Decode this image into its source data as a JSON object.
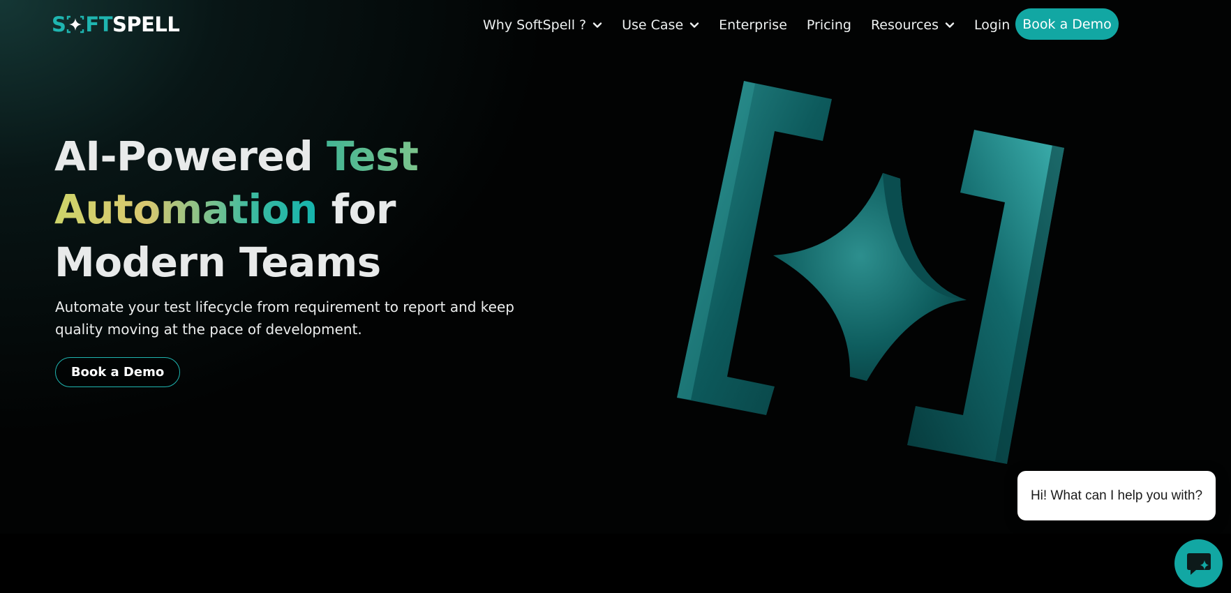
{
  "brand": {
    "logo_part1": "SOFT",
    "logo_part2": "SPELL",
    "accent_color": "#12a7a3"
  },
  "nav": {
    "items": [
      {
        "label": "Why SoftSpell ?",
        "has_dropdown": true
      },
      {
        "label": "Use Case",
        "has_dropdown": true
      },
      {
        "label": "Enterprise",
        "has_dropdown": false
      },
      {
        "label": "Pricing",
        "has_dropdown": false
      },
      {
        "label": "Resources",
        "has_dropdown": true
      }
    ],
    "login": "Login",
    "cta": "Book a Demo"
  },
  "hero": {
    "title_part1": "AI-Powered ",
    "title_highlight1": "Test",
    "title_highlight2": "Automation",
    "title_part2": " for",
    "title_part3": "Modern Teams",
    "subtitle_line1": "Automate your test lifecycle from requirement to report and keep",
    "subtitle_line2": "quality moving at the pace of development.",
    "cta": "Book a Demo"
  },
  "chat": {
    "prompt": "Hi! What can I help you with?"
  },
  "icons": [
    "chevron-down-icon",
    "logo-star-icon",
    "softspell-3d-logo-illustration",
    "chat-icon"
  ]
}
